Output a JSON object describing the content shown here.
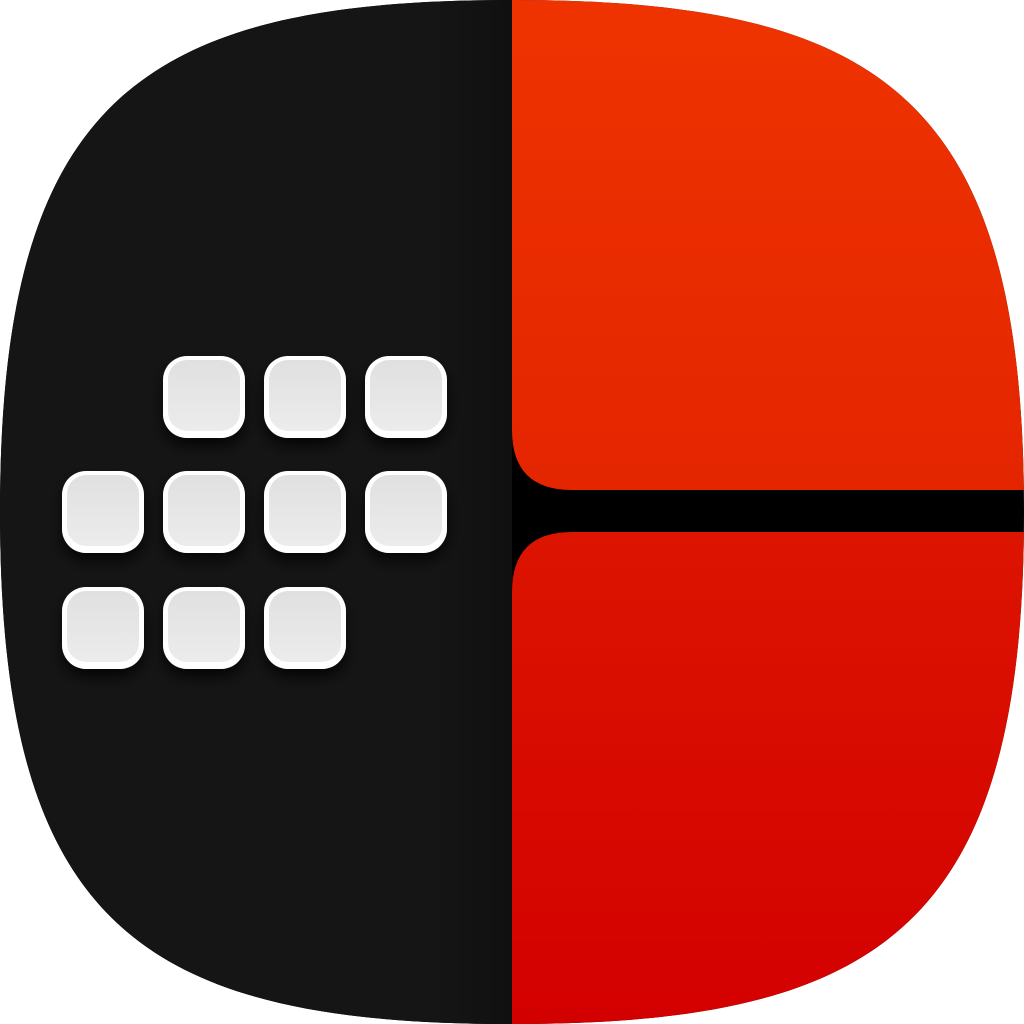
{
  "icon": {
    "name": "app-icon",
    "colors": {
      "dark_panel": "#151515",
      "red_top": "#ee2f00",
      "red_bottom": "#d40000",
      "divider": "#000000",
      "key_face": "#e6e6e6",
      "key_rim": "#ffffff"
    },
    "key_grid": {
      "rows": [
        {
          "name": "top-row",
          "key_count": 3
        },
        {
          "name": "middle-row",
          "key_count": 4
        },
        {
          "name": "bottom-row",
          "key_count": 3
        }
      ]
    }
  }
}
